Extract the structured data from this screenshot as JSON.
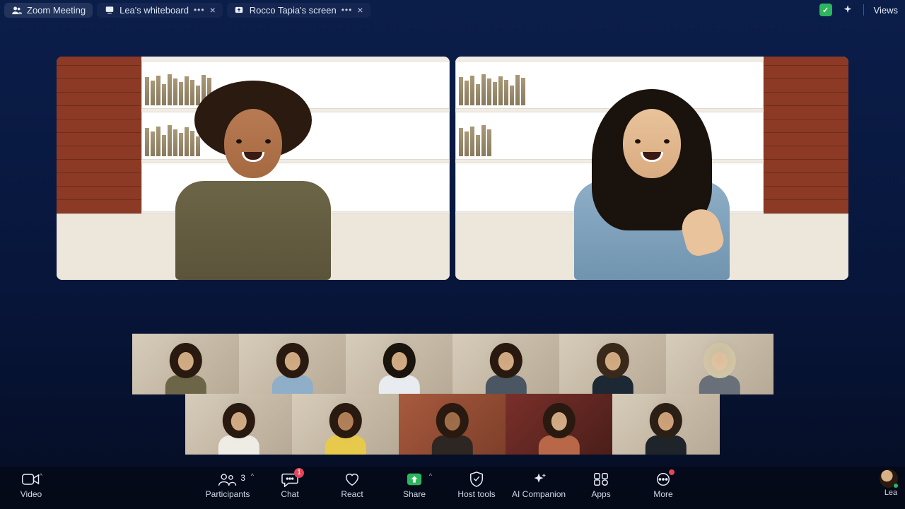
{
  "topbar": {
    "meeting_tab": "Zoom Meeting",
    "tabs": [
      {
        "label": "Lea's whiteboard"
      },
      {
        "label": "Rocco Tapia's screen"
      }
    ],
    "views_label": "Views"
  },
  "toolbar": {
    "video": "Video",
    "participants": "Participants",
    "participants_count": "3",
    "chat": "Chat",
    "chat_badge": "1",
    "react": "React",
    "share": "Share",
    "host_tools": "Host tools",
    "ai_companion": "AI Companion",
    "apps": "Apps",
    "more": "More",
    "leave": "Lea"
  }
}
